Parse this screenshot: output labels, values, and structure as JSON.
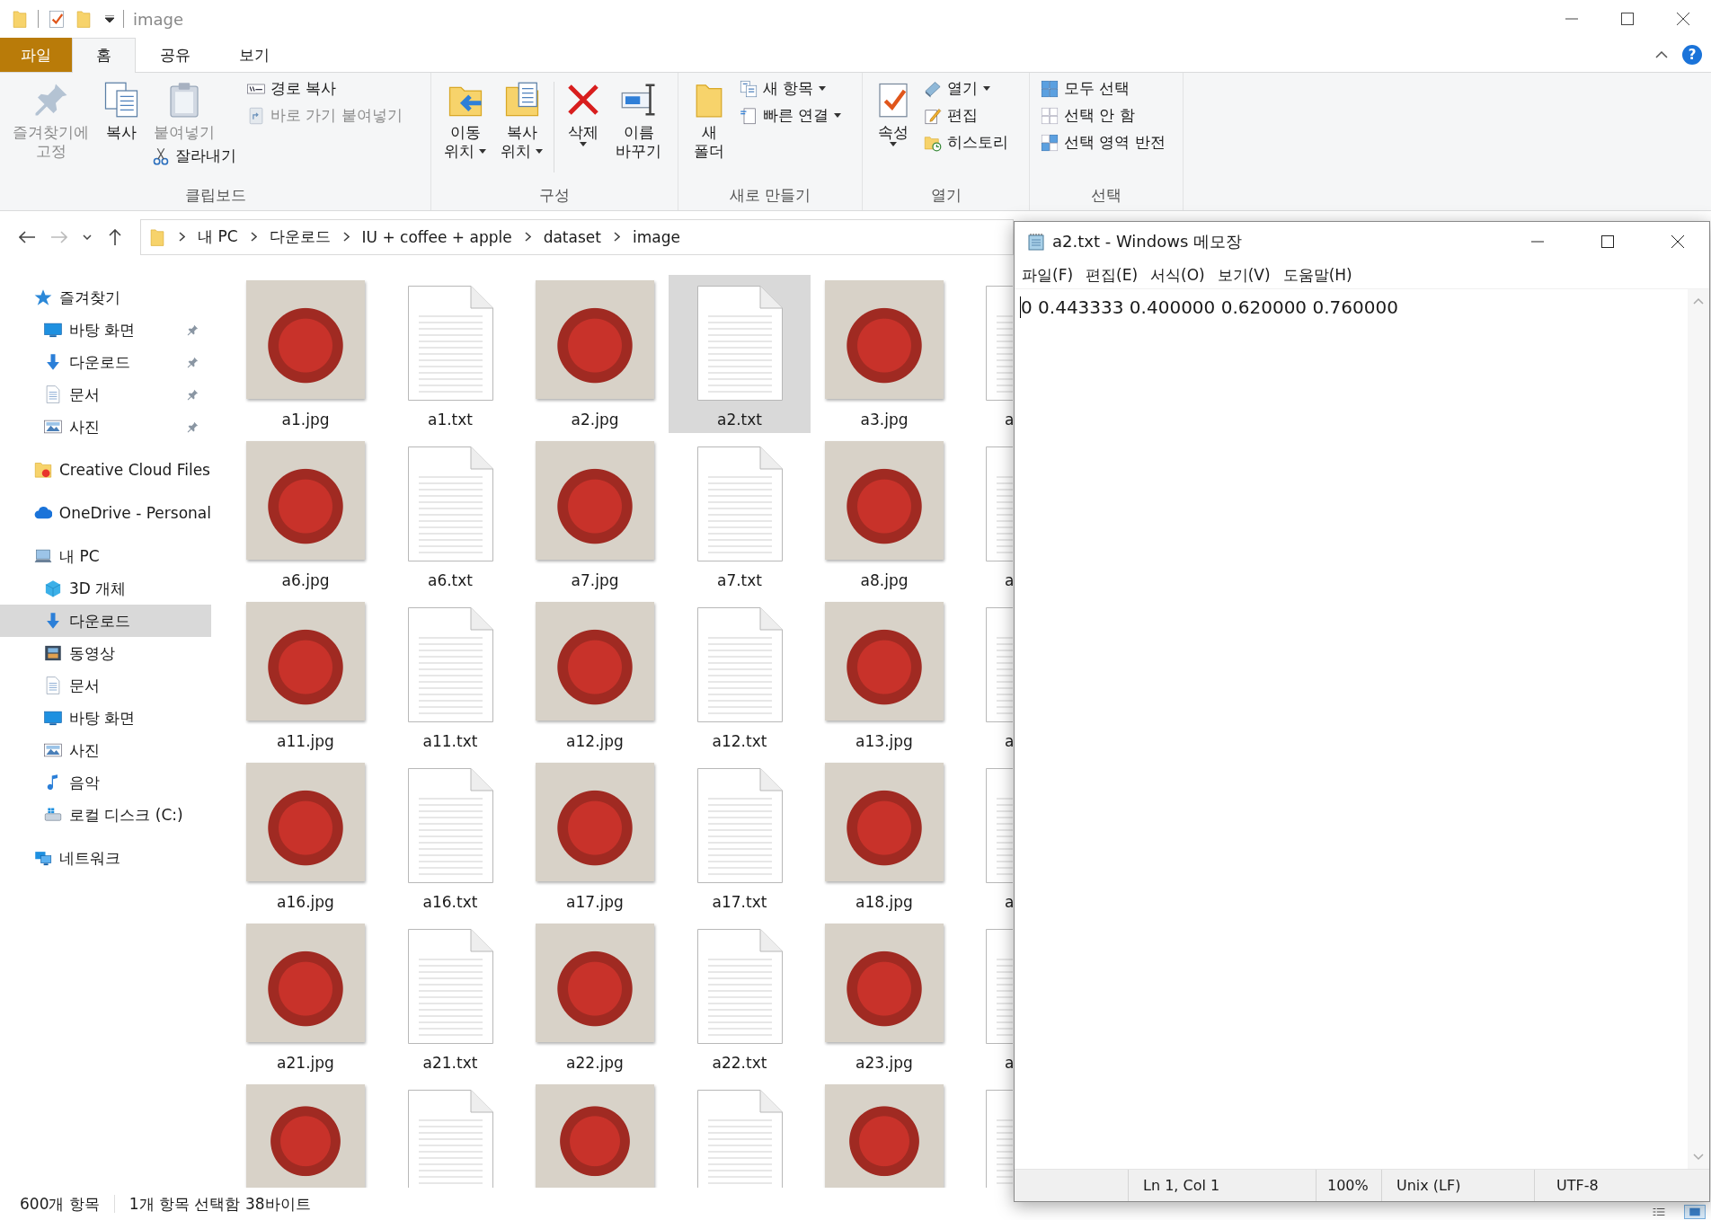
{
  "explorer": {
    "title": "image",
    "ribbon_tabs": [
      {
        "label": "파일",
        "kind": "file",
        "selected": false
      },
      {
        "label": "홈",
        "kind": "tab",
        "selected": true
      },
      {
        "label": "공유",
        "kind": "tab",
        "selected": false
      },
      {
        "label": "보기",
        "kind": "tab",
        "selected": false
      }
    ],
    "help_label": "?",
    "ribbon_groups": [
      {
        "label": "클립보드",
        "columns": [
          {
            "buttons": [
              {
                "kind": "tall",
                "lines": [
                  "즐겨찾기에",
                  "고정"
                ],
                "dropdown": false,
                "disabled": true
              }
            ]
          },
          {
            "buttons": [
              {
                "kind": "tall",
                "lines": [
                  "복사"
                ],
                "dropdown": false,
                "disabled": false
              }
            ]
          },
          {
            "buttons": [
              {
                "kind": "tall",
                "lines": [
                  "붙여넣기"
                ],
                "dropdown": false,
                "disabled": true
              },
              {
                "kind": "small",
                "lines": [
                  "잘라내기"
                ],
                "dropdown": false,
                "disabled": false
              }
            ]
          },
          {
            "buttons": [
              {
                "kind": "small",
                "lines": [
                  "경로 복사"
                ],
                "dropdown": false,
                "disabled": false
              },
              {
                "kind": "small",
                "lines": [
                  "바로 가기 붙여넣기"
                ],
                "dropdown": false,
                "disabled": true
              }
            ]
          }
        ]
      },
      {
        "label": "구성",
        "columns": [
          {
            "buttons": [
              {
                "kind": "tall",
                "lines": [
                  "이동",
                  "위치"
                ],
                "dropdown": true,
                "disabled": false
              }
            ]
          },
          {
            "buttons": [
              {
                "kind": "tall",
                "lines": [
                  "복사",
                  "위치"
                ],
                "dropdown": true,
                "disabled": false
              }
            ]
          },
          {
            "buttons": [
              {
                "kind": "tall",
                "lines": [
                  "삭제"
                ],
                "dropdown": true,
                "disabled": false
              }
            ]
          },
          {
            "buttons": [
              {
                "kind": "tall",
                "lines": [
                  "이름",
                  "바꾸기"
                ],
                "dropdown": false,
                "disabled": false
              }
            ]
          }
        ]
      },
      {
        "label": "새로 만들기",
        "columns": [
          {
            "buttons": [
              {
                "kind": "tall",
                "lines": [
                  "새",
                  "폴더"
                ],
                "dropdown": false,
                "disabled": false
              }
            ]
          },
          {
            "buttons": [
              {
                "kind": "small",
                "lines": [
                  "새 항목"
                ],
                "dropdown": true,
                "disabled": false
              },
              {
                "kind": "small",
                "lines": [
                  "빠른 연결"
                ],
                "dropdown": true,
                "disabled": false
              }
            ]
          }
        ]
      },
      {
        "label": "열기",
        "columns": [
          {
            "buttons": [
              {
                "kind": "tall",
                "lines": [
                  "속성"
                ],
                "dropdown": true,
                "disabled": false
              }
            ]
          },
          {
            "buttons": [
              {
                "kind": "small",
                "lines": [
                  "열기"
                ],
                "dropdown": true,
                "disabled": false
              },
              {
                "kind": "small",
                "lines": [
                  "편집"
                ],
                "dropdown": false,
                "disabled": false
              },
              {
                "kind": "small",
                "lines": [
                  "히스토리"
                ],
                "dropdown": false,
                "disabled": false
              }
            ]
          }
        ]
      },
      {
        "label": "선택",
        "columns": [
          {
            "buttons": [
              {
                "kind": "small",
                "lines": [
                  "모두 선택"
                ],
                "dropdown": false,
                "disabled": false
              },
              {
                "kind": "small",
                "lines": [
                  "선택 안 함"
                ],
                "dropdown": false,
                "disabled": false
              },
              {
                "kind": "small",
                "lines": [
                  "선택 영역 반전"
                ],
                "dropdown": false,
                "disabled": false
              }
            ]
          }
        ]
      }
    ],
    "nav": {
      "back_disabled": false,
      "forward_disabled": true
    },
    "breadcrumbs": [
      "내 PC",
      "다운로드",
      "IU + coffee + apple",
      "dataset",
      "image"
    ],
    "nav_pane": [
      {
        "label": "즐겨찾기",
        "selected": false,
        "children": [
          {
            "label": "바탕 화면",
            "pinned": true,
            "selected": false
          },
          {
            "label": "다운로드",
            "pinned": true,
            "selected": false
          },
          {
            "label": "문서",
            "pinned": true,
            "selected": false
          },
          {
            "label": "사진",
            "pinned": true,
            "selected": false
          }
        ]
      },
      {
        "label": "Creative Cloud Files",
        "selected": false
      },
      {
        "label": "OneDrive - Personal",
        "selected": false
      },
      {
        "label": "내 PC",
        "selected": false,
        "children": [
          {
            "label": "3D 개체",
            "selected": false
          },
          {
            "label": "다운로드",
            "selected": true
          },
          {
            "label": "동영상",
            "selected": false
          },
          {
            "label": "문서",
            "selected": false
          },
          {
            "label": "바탕 화면",
            "selected": false
          },
          {
            "label": "사진",
            "selected": false
          },
          {
            "label": "음악",
            "selected": false
          },
          {
            "label": "로컬 디스크 (C:)",
            "selected": false
          }
        ]
      },
      {
        "label": "네트워크",
        "selected": false
      }
    ],
    "files": [
      {
        "label": "a1.jpg",
        "kind": "image",
        "selected": false
      },
      {
        "label": "a1.txt",
        "kind": "text",
        "selected": false
      },
      {
        "label": "a2.jpg",
        "kind": "image",
        "selected": false
      },
      {
        "label": "a2.txt",
        "kind": "text",
        "selected": true
      },
      {
        "label": "a3.jpg",
        "kind": "image",
        "selected": false
      },
      {
        "label": "a",
        "kind": "text",
        "selected": false
      },
      {
        "label": "a6.jpg",
        "kind": "image",
        "selected": false
      },
      {
        "label": "a6.txt",
        "kind": "text",
        "selected": false
      },
      {
        "label": "a7.jpg",
        "kind": "image",
        "selected": false
      },
      {
        "label": "a7.txt",
        "kind": "text",
        "selected": false
      },
      {
        "label": "a8.jpg",
        "kind": "image",
        "selected": false
      },
      {
        "label": "a",
        "kind": "text",
        "selected": false
      },
      {
        "label": "a11.jpg",
        "kind": "image",
        "selected": false
      },
      {
        "label": "a11.txt",
        "kind": "text",
        "selected": false
      },
      {
        "label": "a12.jpg",
        "kind": "image",
        "selected": false
      },
      {
        "label": "a12.txt",
        "kind": "text",
        "selected": false
      },
      {
        "label": "a13.jpg",
        "kind": "image",
        "selected": false
      },
      {
        "label": "a",
        "kind": "text",
        "selected": false
      },
      {
        "label": "a16.jpg",
        "kind": "image",
        "selected": false
      },
      {
        "label": "a16.txt",
        "kind": "text",
        "selected": false
      },
      {
        "label": "a17.jpg",
        "kind": "image",
        "selected": false
      },
      {
        "label": "a17.txt",
        "kind": "text",
        "selected": false
      },
      {
        "label": "a18.jpg",
        "kind": "image",
        "selected": false
      },
      {
        "label": "a",
        "kind": "text",
        "selected": false
      },
      {
        "label": "a21.jpg",
        "kind": "image",
        "selected": false
      },
      {
        "label": "a21.txt",
        "kind": "text",
        "selected": false
      },
      {
        "label": "a22.jpg",
        "kind": "image",
        "selected": false
      },
      {
        "label": "a22.txt",
        "kind": "text",
        "selected": false
      },
      {
        "label": "a23.jpg",
        "kind": "image",
        "selected": false
      },
      {
        "label": "a",
        "kind": "text",
        "selected": false
      },
      {
        "kind": "image",
        "selected": false
      },
      {
        "kind": "text",
        "selected": false
      },
      {
        "kind": "image",
        "selected": false
      },
      {
        "kind": "text",
        "selected": false
      },
      {
        "kind": "image",
        "selected": false
      },
      {
        "kind": "text",
        "selected": false
      }
    ],
    "status": {
      "item_count": "600개 항목",
      "selection": "1개 항목 선택함 38바이트"
    }
  },
  "notepad": {
    "title": "a2.txt - Windows 메모장",
    "menu": [
      "파일(F)",
      "편집(E)",
      "서식(O)",
      "보기(V)",
      "도움말(H)"
    ],
    "content": "0 0.443333 0.400000 0.620000 0.760000",
    "status": [
      "Ln 1, Col 1",
      "100%",
      "Unix (LF)",
      "UTF-8"
    ]
  }
}
